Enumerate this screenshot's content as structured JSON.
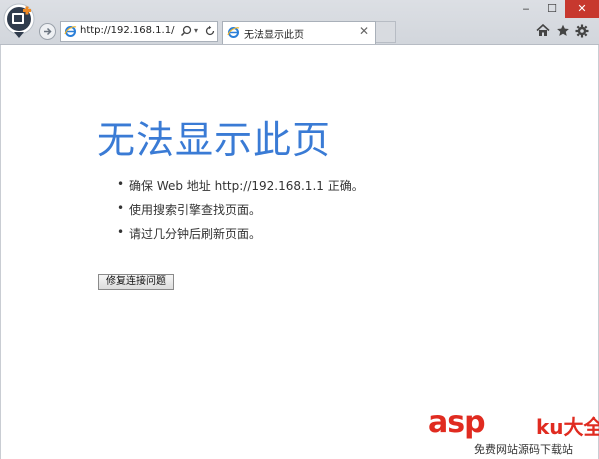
{
  "browser": {
    "address": "http://192.168.1.1/",
    "tab_title": "无法显示此页",
    "tab_close": "✕",
    "dropdown_symbol": "▾",
    "window_buttons": {
      "minimize": "‒",
      "maximize": "☐",
      "close": "✕"
    }
  },
  "page": {
    "title": "无法显示此页",
    "bullet": "•",
    "suggestions": [
      "确保 Web 地址 http://192.168.1.1 正确。",
      "使用搜索引擎查找页面。",
      "请过几分钟后刷新页面。"
    ],
    "fix_button": "修复连接问题"
  },
  "watermark": {
    "brand": "asp",
    "suffix": "ku大全",
    "tagline": "免费网站源码下载站"
  },
  "colors": {
    "title_blue": "#3a7bd5",
    "close_red": "#c7382e",
    "watermark_red": "#e02b20"
  }
}
